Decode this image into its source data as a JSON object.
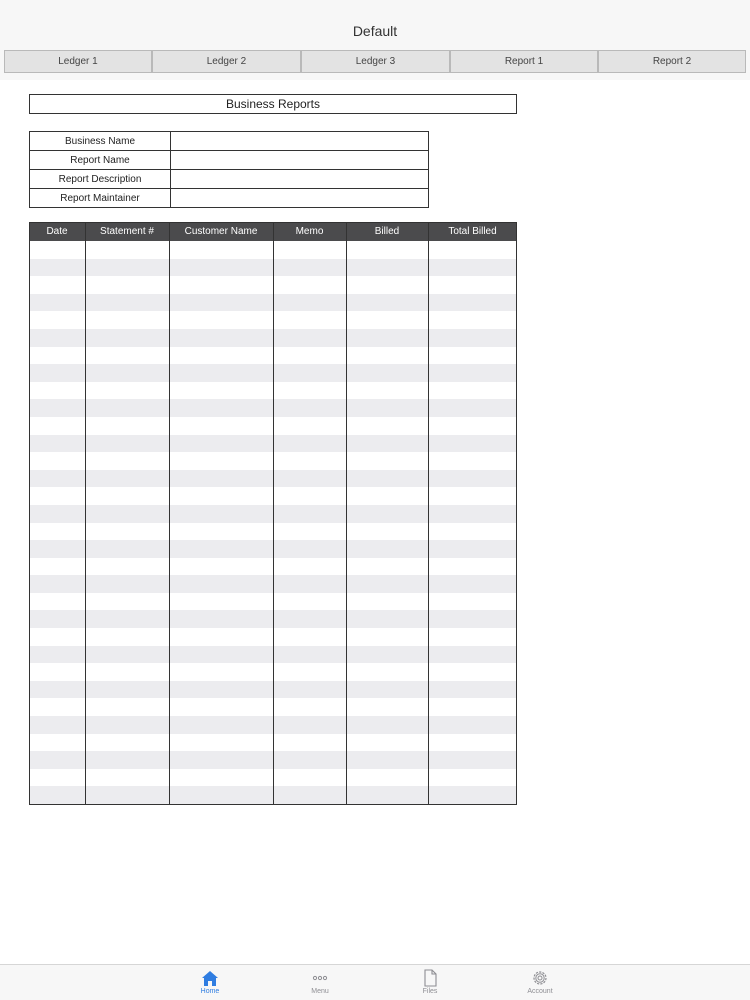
{
  "nav": {
    "title": "Default"
  },
  "tabs": [
    {
      "label": "Ledger 1"
    },
    {
      "label": "Ledger 2"
    },
    {
      "label": "Ledger 3"
    },
    {
      "label": "Report 1"
    },
    {
      "label": "Report 2"
    }
  ],
  "report": {
    "title": "Business Reports",
    "fields": [
      {
        "label": "Business Name",
        "value": ""
      },
      {
        "label": "Report Name",
        "value": ""
      },
      {
        "label": "Report Description",
        "value": ""
      },
      {
        "label": "Report Maintainer",
        "value": ""
      }
    ]
  },
  "table": {
    "columns": [
      "Date",
      "Statement #",
      "Customer Name",
      "Memo",
      "Billed",
      "Total Billed"
    ]
  },
  "tabbar": {
    "items": [
      {
        "label": "Home",
        "icon": "home-icon",
        "active": true
      },
      {
        "label": "Menu",
        "icon": "more-icon",
        "active": false
      },
      {
        "label": "Files",
        "icon": "file-icon",
        "active": false
      },
      {
        "label": "Account",
        "icon": "gear-icon",
        "active": false
      }
    ],
    "active_color": "#2f7de1",
    "inactive_color": "#8e8e93"
  }
}
